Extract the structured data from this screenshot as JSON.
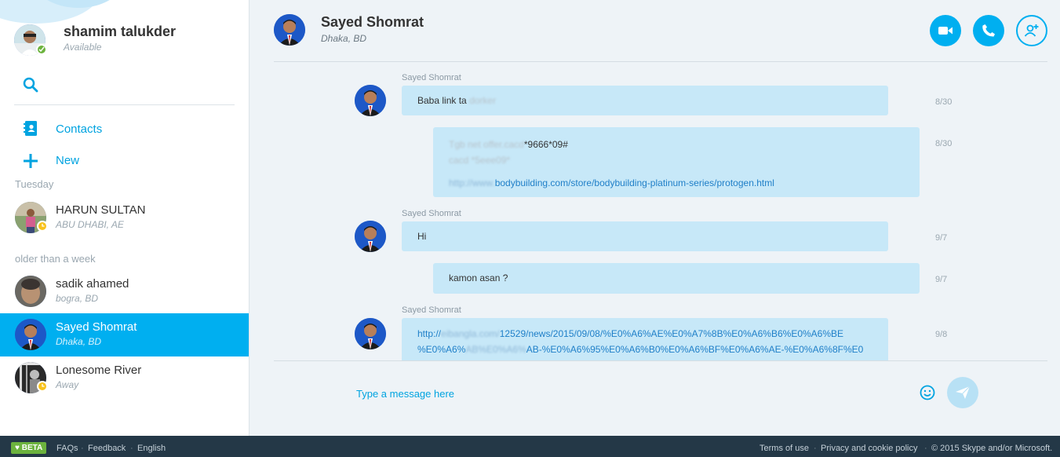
{
  "me": {
    "name": "shamim talukder",
    "status": "Available"
  },
  "nav": {
    "contacts": "Contacts",
    "new": "New"
  },
  "groups": {
    "recent": "Tuesday",
    "older": "older than a week"
  },
  "contacts": [
    {
      "name": "HARUN SULTAN",
      "location": "ABU DHABI, AE",
      "status": "away"
    },
    {
      "name": "sadik ahamed",
      "location": "bogra, BD",
      "status": "none"
    },
    {
      "name": "Sayed Shomrat",
      "location": "Dhaka, BD",
      "status": "none",
      "selected": true
    },
    {
      "name": "Lonesome River",
      "location": "Away",
      "status": "away"
    }
  ],
  "conversation": {
    "name": "Sayed Shomrat",
    "location": "Dhaka, BD"
  },
  "header_buttons": {
    "video": "video-call",
    "call": "audio-call",
    "add": "add-participant"
  },
  "messages": [
    {
      "sender": "Sayed Shomrat",
      "text": "Baba link ta",
      "text_blurred": "dorker",
      "time": "8/30"
    },
    {
      "line1_blurred": "Tgb net offer.cacd",
      "line1": "*9666*09#",
      "line2_blurred": "cacd *5eee09*",
      "link_blurred": "http://www.",
      "link": "bodybuilding.com/store/bodybuilding-platinum-series/protogen.html",
      "time": "8/30"
    },
    {
      "sender": "Sayed Shomrat",
      "text": "Hi",
      "time": "9/7"
    },
    {
      "text": "kamon asan ?",
      "time": "9/7"
    },
    {
      "sender": "Sayed Shomrat",
      "link_line1_a": "http://",
      "link_line1_blurred": "eibangla.com/",
      "link_line1_b": "12529/news/2015/09/08/%E0%A6%AE%E0%A7%8B%E0%A6%B6%E0%A6%BE",
      "link_line2_a": "%E0%A6%",
      "link_line2_blurred": "AB%E0%A6%",
      "link_line2_b": "AB-%E0%A6%95%E0%A6%B0%E0%A6%BF%E0%A6%AE-%E0%A6%8F%E0",
      "time": "9/8"
    }
  ],
  "composer": {
    "placeholder": "Type a message here"
  },
  "footer": {
    "beta": "BETA",
    "faqs": "FAQs",
    "feedback": "Feedback",
    "language": "English",
    "terms": "Terms of use",
    "privacy": "Privacy and cookie policy",
    "copyright": "© 2015 Skype and/or Microsoft."
  },
  "colors": {
    "accent": "#00aff0",
    "bubble": "#c7e8f8",
    "footer": "#243847",
    "online": "#6cb33e",
    "away": "#f8c21c"
  }
}
